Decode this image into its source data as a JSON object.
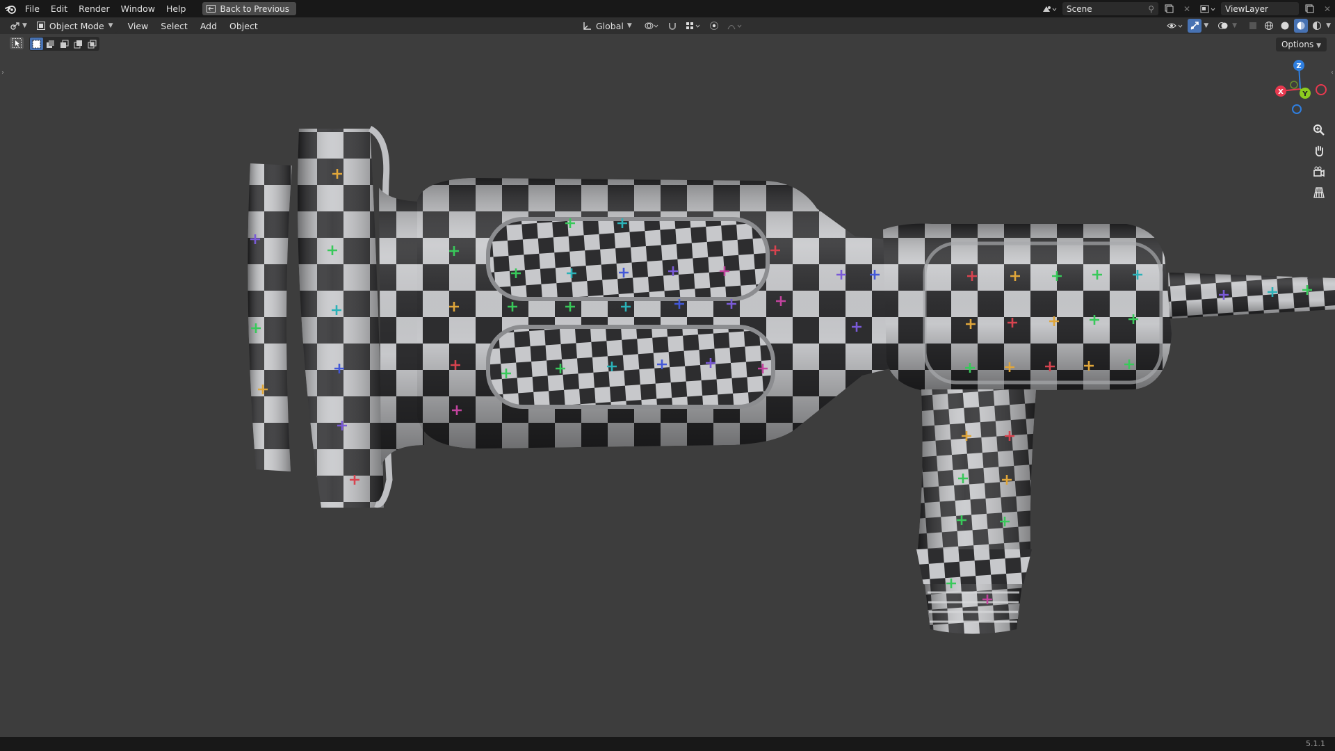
{
  "topbar": {
    "menu": [
      "File",
      "Edit",
      "Render",
      "Window",
      "Help"
    ],
    "back_label": "Back to Previous",
    "scene_name": "Scene",
    "view_layer": "ViewLayer"
  },
  "header": {
    "mode": "Object Mode",
    "menus": [
      "View",
      "Select",
      "Add",
      "Object"
    ],
    "transform_orientation": "Global",
    "options_label": "Options"
  },
  "viewport": {
    "background": "#3d3d3d",
    "gizmo_axes": {
      "z": "Z",
      "y": "Y",
      "x": "X"
    },
    "axis_colors": {
      "x": "#e8394f",
      "y": "#8ccc1f",
      "z": "#2f7fe0"
    },
    "model_texture": "checker (dark #2e2e2e / light #c8c8c8) with coloured crosses"
  },
  "status": {
    "version": "5.1.1"
  },
  "colors": {
    "accent": "#4772b3",
    "topbar": "#181818",
    "header": "#2f2f2f"
  }
}
